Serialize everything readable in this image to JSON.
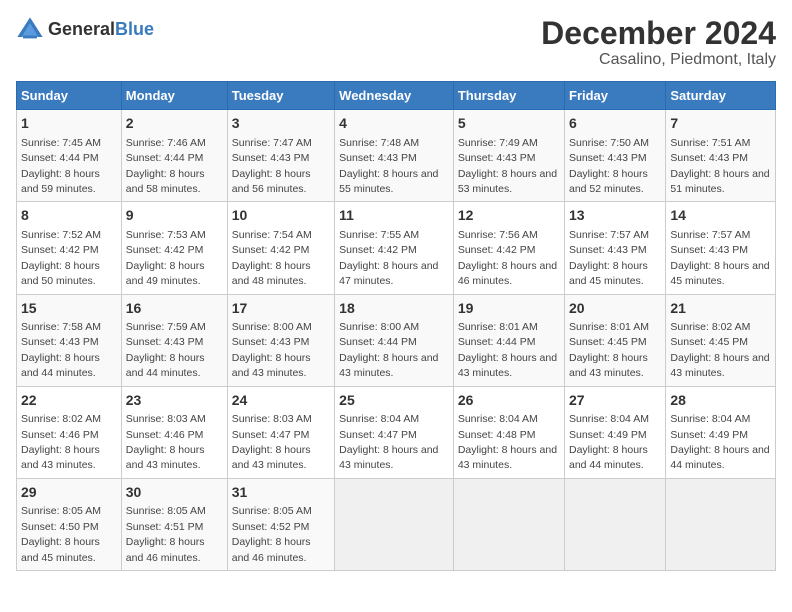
{
  "logo": {
    "general": "General",
    "blue": "Blue"
  },
  "title": "December 2024",
  "subtitle": "Casalino, Piedmont, Italy",
  "days_header": [
    "Sunday",
    "Monday",
    "Tuesday",
    "Wednesday",
    "Thursday",
    "Friday",
    "Saturday"
  ],
  "weeks": [
    [
      {
        "day": "1",
        "sunrise": "7:45 AM",
        "sunset": "4:44 PM",
        "daylight": "8 hours and 59 minutes."
      },
      {
        "day": "2",
        "sunrise": "7:46 AM",
        "sunset": "4:44 PM",
        "daylight": "8 hours and 58 minutes."
      },
      {
        "day": "3",
        "sunrise": "7:47 AM",
        "sunset": "4:43 PM",
        "daylight": "8 hours and 56 minutes."
      },
      {
        "day": "4",
        "sunrise": "7:48 AM",
        "sunset": "4:43 PM",
        "daylight": "8 hours and 55 minutes."
      },
      {
        "day": "5",
        "sunrise": "7:49 AM",
        "sunset": "4:43 PM",
        "daylight": "8 hours and 53 minutes."
      },
      {
        "day": "6",
        "sunrise": "7:50 AM",
        "sunset": "4:43 PM",
        "daylight": "8 hours and 52 minutes."
      },
      {
        "day": "7",
        "sunrise": "7:51 AM",
        "sunset": "4:43 PM",
        "daylight": "8 hours and 51 minutes."
      }
    ],
    [
      {
        "day": "8",
        "sunrise": "7:52 AM",
        "sunset": "4:42 PM",
        "daylight": "8 hours and 50 minutes."
      },
      {
        "day": "9",
        "sunrise": "7:53 AM",
        "sunset": "4:42 PM",
        "daylight": "8 hours and 49 minutes."
      },
      {
        "day": "10",
        "sunrise": "7:54 AM",
        "sunset": "4:42 PM",
        "daylight": "8 hours and 48 minutes."
      },
      {
        "day": "11",
        "sunrise": "7:55 AM",
        "sunset": "4:42 PM",
        "daylight": "8 hours and 47 minutes."
      },
      {
        "day": "12",
        "sunrise": "7:56 AM",
        "sunset": "4:42 PM",
        "daylight": "8 hours and 46 minutes."
      },
      {
        "day": "13",
        "sunrise": "7:57 AM",
        "sunset": "4:43 PM",
        "daylight": "8 hours and 45 minutes."
      },
      {
        "day": "14",
        "sunrise": "7:57 AM",
        "sunset": "4:43 PM",
        "daylight": "8 hours and 45 minutes."
      }
    ],
    [
      {
        "day": "15",
        "sunrise": "7:58 AM",
        "sunset": "4:43 PM",
        "daylight": "8 hours and 44 minutes."
      },
      {
        "day": "16",
        "sunrise": "7:59 AM",
        "sunset": "4:43 PM",
        "daylight": "8 hours and 44 minutes."
      },
      {
        "day": "17",
        "sunrise": "8:00 AM",
        "sunset": "4:43 PM",
        "daylight": "8 hours and 43 minutes."
      },
      {
        "day": "18",
        "sunrise": "8:00 AM",
        "sunset": "4:44 PM",
        "daylight": "8 hours and 43 minutes."
      },
      {
        "day": "19",
        "sunrise": "8:01 AM",
        "sunset": "4:44 PM",
        "daylight": "8 hours and 43 minutes."
      },
      {
        "day": "20",
        "sunrise": "8:01 AM",
        "sunset": "4:45 PM",
        "daylight": "8 hours and 43 minutes."
      },
      {
        "day": "21",
        "sunrise": "8:02 AM",
        "sunset": "4:45 PM",
        "daylight": "8 hours and 43 minutes."
      }
    ],
    [
      {
        "day": "22",
        "sunrise": "8:02 AM",
        "sunset": "4:46 PM",
        "daylight": "8 hours and 43 minutes."
      },
      {
        "day": "23",
        "sunrise": "8:03 AM",
        "sunset": "4:46 PM",
        "daylight": "8 hours and 43 minutes."
      },
      {
        "day": "24",
        "sunrise": "8:03 AM",
        "sunset": "4:47 PM",
        "daylight": "8 hours and 43 minutes."
      },
      {
        "day": "25",
        "sunrise": "8:04 AM",
        "sunset": "4:47 PM",
        "daylight": "8 hours and 43 minutes."
      },
      {
        "day": "26",
        "sunrise": "8:04 AM",
        "sunset": "4:48 PM",
        "daylight": "8 hours and 43 minutes."
      },
      {
        "day": "27",
        "sunrise": "8:04 AM",
        "sunset": "4:49 PM",
        "daylight": "8 hours and 44 minutes."
      },
      {
        "day": "28",
        "sunrise": "8:04 AM",
        "sunset": "4:49 PM",
        "daylight": "8 hours and 44 minutes."
      }
    ],
    [
      {
        "day": "29",
        "sunrise": "8:05 AM",
        "sunset": "4:50 PM",
        "daylight": "8 hours and 45 minutes."
      },
      {
        "day": "30",
        "sunrise": "8:05 AM",
        "sunset": "4:51 PM",
        "daylight": "8 hours and 46 minutes."
      },
      {
        "day": "31",
        "sunrise": "8:05 AM",
        "sunset": "4:52 PM",
        "daylight": "8 hours and 46 minutes."
      },
      null,
      null,
      null,
      null
    ]
  ],
  "labels": {
    "sunrise": "Sunrise:",
    "sunset": "Sunset:",
    "daylight": "Daylight:"
  }
}
